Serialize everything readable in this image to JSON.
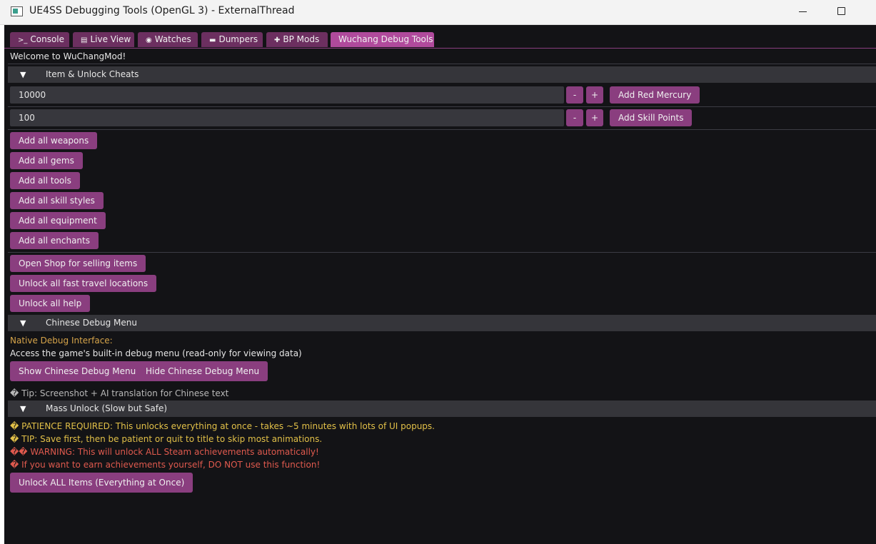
{
  "window": {
    "title": "UE4SS Debugging Tools (OpenGL 3) - ExternalThread"
  },
  "tabs": [
    {
      "icon": ">_",
      "label": "Console"
    },
    {
      "icon": "▤",
      "label": "Live View"
    },
    {
      "icon": "◉",
      "label": "Watches"
    },
    {
      "icon": "▬",
      "label": "Dumpers"
    },
    {
      "icon": "✚",
      "label": "BP Mods"
    },
    {
      "icon": "",
      "label": "Wuchang Debug Tools"
    }
  ],
  "welcome": "Welcome to WuChangMod!",
  "sections": {
    "item_unlock": {
      "header": "Item & Unlock Cheats",
      "arrow": "▼",
      "red_mercury": {
        "value": "10000",
        "minus": "-",
        "plus": "+",
        "button": "Add Red Mercury"
      },
      "skill_points": {
        "value": "100",
        "minus": "-",
        "plus": "+",
        "button": "Add Skill Points"
      },
      "add_buttons": [
        "Add all weapons",
        "Add all gems",
        "Add all tools",
        "Add all skill styles",
        "Add all equipment",
        "Add all enchants"
      ],
      "misc_buttons": [
        "Open Shop for selling items",
        "Unlock all fast travel locations",
        "Unlock all help"
      ]
    },
    "chinese_debug": {
      "header": "Chinese Debug Menu",
      "arrow": "▼",
      "native_label": "Native Debug Interface:",
      "description": "Access the game's built-in debug menu (read-only for viewing data)",
      "show_button": "Show Chinese Debug Menu",
      "hide_button": "Hide Chinese Debug Menu",
      "tip": "� Tip: Screenshot + AI translation for Chinese text"
    },
    "mass_unlock": {
      "header": "Mass Unlock (Slow but Safe)",
      "arrow": "▼",
      "line1": "� PATIENCE REQUIRED: This unlocks everything at once - takes ~5 minutes with lots of UI popups.",
      "line2": "� TIP: Save first, then be patient or quit to title to skip most animations.",
      "line3": "�� WARNING: This will unlock ALL Steam achievements automatically!",
      "line4": "� If you want to earn achievements yourself, DO NOT use this function!",
      "button": "Unlock ALL Items (Everything at Once)"
    }
  },
  "colors": {
    "accent": "#8a3e7f",
    "accent_active": "#b04a9c",
    "background": "#131316",
    "header_bg": "#35353a",
    "warning_yellow": "#e2c048",
    "warning_red": "#e05a4e"
  }
}
